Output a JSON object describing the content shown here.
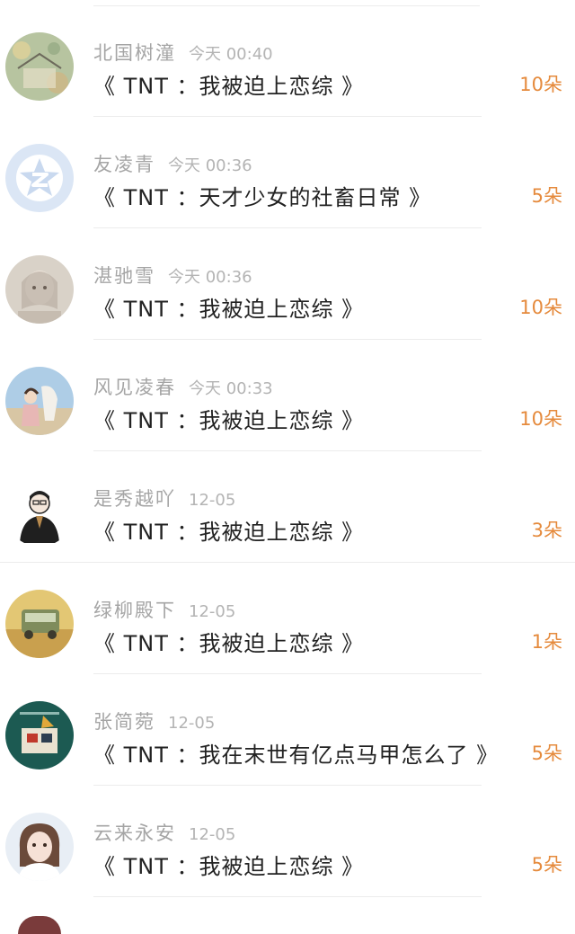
{
  "list": {
    "items": [
      {
        "username": "北国树潼",
        "time": "今天 00:40",
        "title": "《 TNT ：我被迫上恋综 》",
        "count": "10朵"
      },
      {
        "username": "友凌青",
        "time": "今天 00:36",
        "title": "《 TNT ：天才少女的社畜日常 》",
        "count": "5朵"
      },
      {
        "username": "湛驰雪",
        "time": "今天 00:36",
        "title": "《 TNT ：我被迫上恋综 》",
        "count": "10朵"
      },
      {
        "username": "风见凌春",
        "time": "今天 00:33",
        "title": "《 TNT ：我被迫上恋综 》",
        "count": "10朵"
      },
      {
        "username": "是秀越吖",
        "time": "12-05",
        "title": "《 TNT ：我被迫上恋综 》",
        "count": "3朵"
      },
      {
        "username": "绿柳殿下",
        "time": "12-05",
        "title": "《 TNT ：我被迫上恋综 》",
        "count": "1朵"
      },
      {
        "username": "张简菀",
        "time": "12-05",
        "title": "《 TNT ：我在末世有亿点马甲怎么了 》",
        "count": "5朵"
      },
      {
        "username": "云来永安",
        "time": "12-05",
        "title": "《 TNT ：我被迫上恋综 》",
        "count": "5朵"
      }
    ]
  },
  "colors": {
    "accent": "#e58a3c",
    "username": "#a5a5a5",
    "time": "#b4b4b4",
    "title": "#222222",
    "divider": "#ececec"
  },
  "icons": {
    "default_avatar": "star-qq-avatar-icon"
  }
}
